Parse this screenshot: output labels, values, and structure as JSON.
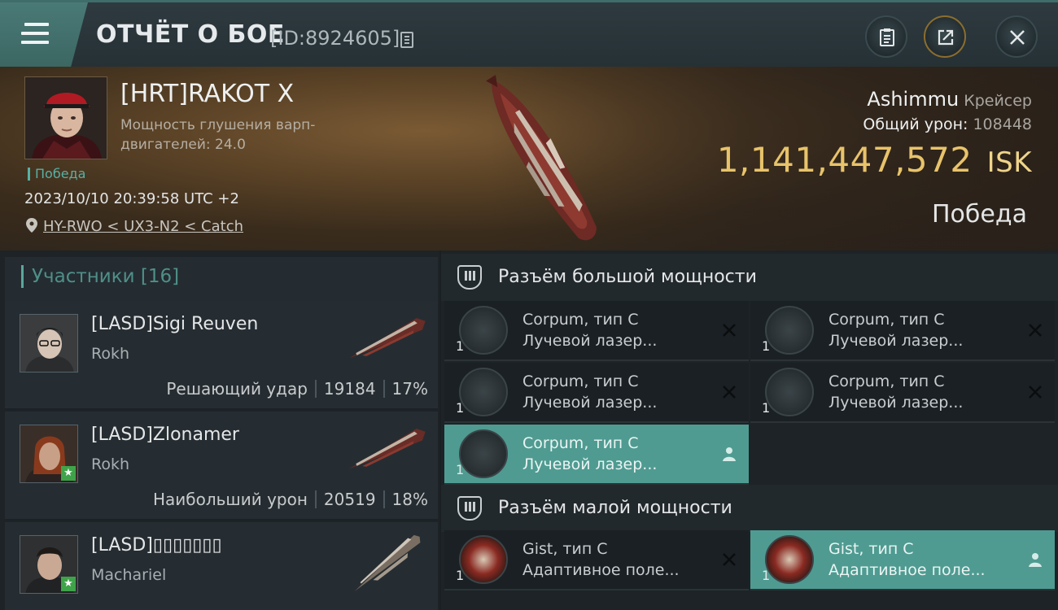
{
  "header": {
    "title": "ОТЧЁТ О БОЕ",
    "report_id": "[ID:8924605]",
    "menu_icon": "hamburger-menu-icon",
    "actions": [
      "notes-icon",
      "share-icon",
      "close-icon"
    ]
  },
  "victim": {
    "name": "[HRT]RAKOT X",
    "warp_label": "Мощность глушения варп-двигателей: 24.0",
    "status": "Победа",
    "datetime": "2023/10/10 20:39:58 UTC +2",
    "location": "HY-RWO < UX3-N2 < Catch",
    "ship": "Ashimmu",
    "ship_class": "Крейсер",
    "total_damage_label": "Общий урон:",
    "total_damage": "108448",
    "isk_value": "1,141,447,572",
    "isk_unit": "ISK",
    "result": "Победа"
  },
  "participants": {
    "header": "Участники [16]",
    "list": [
      {
        "name": "[LASD]Sigi Reuven",
        "ship": "Rokh",
        "role": "Решающий удар",
        "damage": "19184",
        "percent": "17%",
        "starred": false
      },
      {
        "name": "[LASD]Zlonamer",
        "ship": "Rokh",
        "role": "Наибольший урон",
        "damage": "20519",
        "percent": "18%",
        "starred": true
      },
      {
        "name": "[LASD]▯▯▯▯▯▯▯",
        "ship": "Machariel",
        "starred": true
      }
    ]
  },
  "fitting": {
    "high_slot_title": "Разъём большой мощности",
    "low_slot_title": "Разъём малой мощности",
    "high_modules": [
      {
        "name": "Corpum, тип C",
        "type": "Лучевой лазер...",
        "qty": "1",
        "state": "destroyed"
      },
      {
        "name": "Corpum, тип C",
        "type": "Лучевой лазер...",
        "qty": "1",
        "state": "destroyed"
      },
      {
        "name": "Corpum, тип C",
        "type": "Лучевой лазер...",
        "qty": "1",
        "state": "destroyed"
      },
      {
        "name": "Corpum, тип C",
        "type": "Лучевой лазер...",
        "qty": "1",
        "state": "destroyed"
      },
      {
        "name": "Corpum, тип C",
        "type": "Лучевой лазер...",
        "qty": "1",
        "state": "dropped"
      }
    ],
    "low_modules": [
      {
        "name": "Gist, тип C",
        "type": "Адаптивное поле...",
        "qty": "1",
        "state": "destroyed"
      },
      {
        "name": "Gist, тип C",
        "type": "Адаптивное поле...",
        "qty": "1",
        "state": "dropped"
      }
    ]
  },
  "colors": {
    "accent": "#4f9b91",
    "isk": "#e8c36a",
    "victory": "#59b0a5"
  }
}
